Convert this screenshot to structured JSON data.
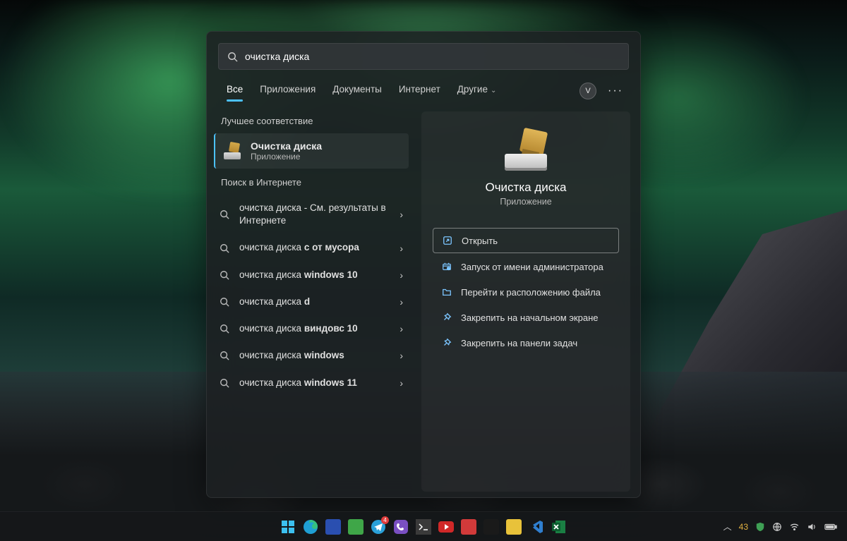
{
  "search": {
    "query": "очистка диска"
  },
  "tabs": {
    "items": [
      "Все",
      "Приложения",
      "Документы",
      "Интернет",
      "Другие"
    ],
    "active": 0,
    "avatar_initial": "V"
  },
  "best_match": {
    "header": "Лучшее соответствие",
    "title": "Очистка диска",
    "subtitle": "Приложение"
  },
  "web_search": {
    "header": "Поиск в Интернете",
    "items": [
      {
        "prefix": "очистка диска",
        "suffix": " - См. результаты в Интернете"
      },
      {
        "prefix": "очистка диска ",
        "bold": "c от мусора"
      },
      {
        "prefix": "очистка диска ",
        "bold": "windows 10"
      },
      {
        "prefix": "очистка диска ",
        "bold": "d"
      },
      {
        "prefix": "очистка диска ",
        "bold": "виндовс 10"
      },
      {
        "prefix": "очистка диска ",
        "bold": "windows"
      },
      {
        "prefix": "очистка диска ",
        "bold": "windows 11"
      }
    ]
  },
  "preview": {
    "title": "Очистка диска",
    "subtitle": "Приложение",
    "actions": [
      {
        "icon": "open",
        "label": "Открыть",
        "primary": true
      },
      {
        "icon": "admin",
        "label": "Запуск от имени администратора"
      },
      {
        "icon": "folder",
        "label": "Перейти к расположению файла"
      },
      {
        "icon": "pin",
        "label": "Закрепить на начальном экране"
      },
      {
        "icon": "pin",
        "label": "Закрепить на панели задач"
      }
    ]
  },
  "taskbar": {
    "temp": "43",
    "apps": [
      {
        "name": "start",
        "color": "#2f7fe0"
      },
      {
        "name": "edge",
        "color": "#1f9fd4"
      },
      {
        "name": "save-floppy",
        "color": "#2a4fb0"
      },
      {
        "name": "green-app",
        "color": "#3fa648"
      },
      {
        "name": "telegram",
        "color": "#2aa0d8",
        "badge": "4"
      },
      {
        "name": "viber",
        "color": "#7a4fc2"
      },
      {
        "name": "terminal",
        "color": "#3a3a3a"
      },
      {
        "name": "youtube",
        "color": "#d02828"
      },
      {
        "name": "opera",
        "color": "#d23a3a"
      },
      {
        "name": "more-app",
        "color": "#1a1a1a"
      },
      {
        "name": "sticky-notes",
        "color": "#e8c23a"
      },
      {
        "name": "vscode",
        "color": "#2f7fd0"
      },
      {
        "name": "excel",
        "color": "#1a7f43"
      }
    ]
  }
}
